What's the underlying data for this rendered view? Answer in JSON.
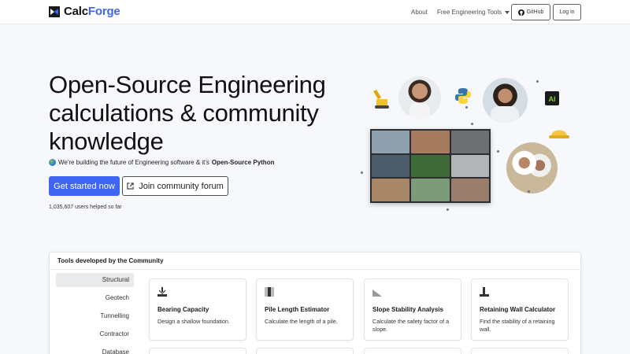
{
  "nav": {
    "brand_part1": "Calc",
    "brand_part2": "Forge",
    "about": "About",
    "tools": "Free Engineering Tools",
    "github": "GitHub",
    "login": "Log in"
  },
  "hero": {
    "title": "Open-Source Engineering calculations & community knowledge",
    "subtitle_prefix": "We're building the future of Engineering software & it's",
    "subtitle_bold": "Open-Source Python",
    "primary_button": "Get started now",
    "forum_button": "Join community forum",
    "users_helped": "1,035,607 users helped so far"
  },
  "tools": {
    "header": "Tools developed by the Community",
    "categories": [
      "Structural",
      "Geotech",
      "Tunnelling",
      "Contractor",
      "Database"
    ],
    "active_category": "Structural",
    "cards": [
      {
        "title": "Bearing Capacity",
        "desc": "Design a shallow foundation.",
        "icon": "foundation-icon"
      },
      {
        "title": "Pile Length Estimator",
        "desc": "Calculate the length of a pile.",
        "icon": "pile-icon"
      },
      {
        "title": "Slope Stability Analysis",
        "desc": "Calculate the safety factor of a slope.",
        "icon": "slope-icon"
      },
      {
        "title": "Retaining Wall Calculator",
        "desc": "Find the stability of a retaining wall.",
        "icon": "retaining-wall-icon"
      }
    ]
  },
  "colors": {
    "accent": "#3f66f2",
    "background": "#f6f8fb"
  }
}
